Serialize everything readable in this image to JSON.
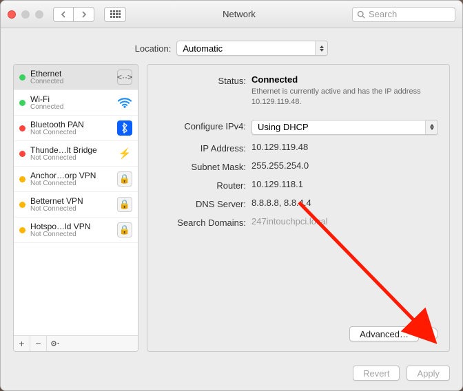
{
  "window": {
    "title": "Network",
    "search_placeholder": "Search"
  },
  "location": {
    "label": "Location:",
    "value": "Automatic"
  },
  "services": [
    {
      "name": "Ethernet",
      "status": "Connected",
      "dot": "green",
      "icon": "eth"
    },
    {
      "name": "Wi-Fi",
      "status": "Connected",
      "dot": "green",
      "icon": "wifi"
    },
    {
      "name": "Bluetooth PAN",
      "status": "Not Connected",
      "dot": "red",
      "icon": "bt"
    },
    {
      "name": "Thunde…lt Bridge",
      "status": "Not Connected",
      "dot": "red",
      "icon": "tb"
    },
    {
      "name": "Anchor…orp VPN",
      "status": "Not Connected",
      "dot": "orange",
      "icon": "lock"
    },
    {
      "name": "Betternet VPN",
      "status": "Not Connected",
      "dot": "orange",
      "icon": "lock"
    },
    {
      "name": "Hotspo…ld VPN",
      "status": "Not Connected",
      "dot": "orange",
      "icon": "lock"
    }
  ],
  "detail": {
    "status_label": "Status:",
    "status_value": "Connected",
    "status_hint": "Ethernet is currently active and has the IP address 10.129.119.48.",
    "config_label": "Configure IPv4:",
    "config_value": "Using DHCP",
    "ip_label": "IP Address:",
    "ip_value": "10.129.119.48",
    "mask_label": "Subnet Mask:",
    "mask_value": "255.255.254.0",
    "router_label": "Router:",
    "router_value": "10.129.118.1",
    "dns_label": "DNS Server:",
    "dns_value": "8.8.8.8, 8.8.4.4",
    "search_label": "Search Domains:",
    "search_value": "247intouchpci.local",
    "advanced_label": "Advanced…"
  },
  "footer": {
    "revert": "Revert",
    "apply": "Apply"
  }
}
